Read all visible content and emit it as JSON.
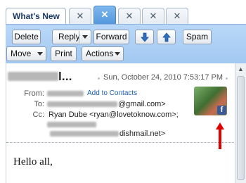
{
  "tabs": [
    {
      "label": "What's New"
    },
    {
      "close_glyph": "✕"
    },
    {
      "close_glyph": "✕",
      "active": true
    },
    {
      "close_glyph": "✕"
    },
    {
      "close_glyph": "✕"
    },
    {
      "close_glyph": "✕"
    }
  ],
  "toolbar": {
    "delete": "Delete",
    "reply": "Reply",
    "forward": "Forward",
    "spam": "Spam",
    "move": "Move",
    "print": "Print",
    "actions": "Actions",
    "down_icon": "arrow-down-icon",
    "up_icon": "arrow-up-icon"
  },
  "message": {
    "subject_visible": "l...",
    "date": "Sun, October 24, 2010 7:53:17 PM",
    "from_label": "From:",
    "add_contacts": "Add to Contacts",
    "to_label": "To:",
    "to_value_visible": "@gmail.com>",
    "cc_label": "Cc:",
    "cc_value": "Ryan Dube <ryan@lovetoknow.com>;",
    "cc_extra_visible": "dishmail.net>",
    "body": "Hello all,"
  },
  "colors": {
    "toolbar_bg": "#aacdf3",
    "active_tab": "#5d9fe2",
    "facebook": "#3b5998",
    "arrow": "#e00000"
  }
}
